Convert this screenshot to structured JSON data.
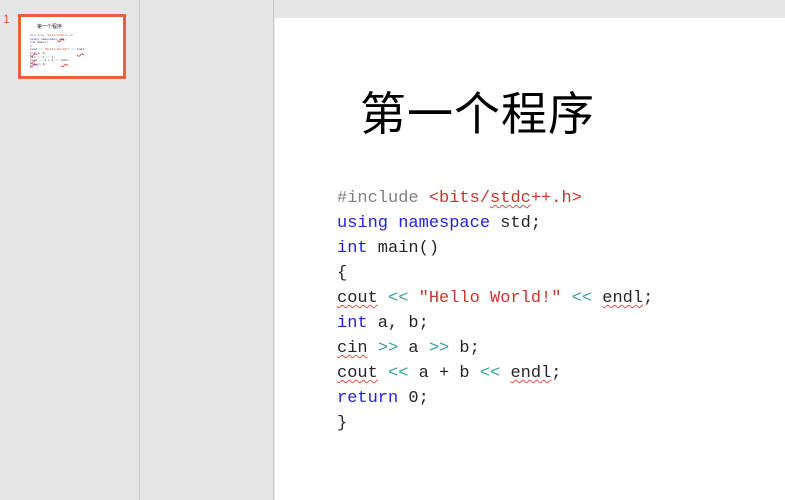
{
  "thumbnail_pane": {
    "slide_number": "1",
    "thumb_title": "第一个程序"
  },
  "slide": {
    "title": "第一个程序",
    "code_lines": [
      {
        "id": "line-include",
        "tokens": [
          {
            "text": "#include ",
            "color": "gray",
            "squiggle": false
          },
          {
            "text": "<bits/",
            "color": "red",
            "squiggle": false
          },
          {
            "text": "stdc",
            "color": "red",
            "squiggle": true
          },
          {
            "text": "++.h>",
            "color": "red",
            "squiggle": false
          }
        ]
      },
      {
        "id": "line-using",
        "tokens": [
          {
            "text": "using namespace",
            "color": "blue",
            "squiggle": false
          },
          {
            "text": " std;",
            "color": "black",
            "squiggle": false
          }
        ]
      },
      {
        "id": "line-main",
        "tokens": [
          {
            "text": "int",
            "color": "blue",
            "squiggle": false
          },
          {
            "text": " main()",
            "color": "black",
            "squiggle": false
          }
        ]
      },
      {
        "id": "line-open-brace",
        "tokens": [
          {
            "text": "{",
            "color": "black",
            "squiggle": false
          }
        ]
      },
      {
        "id": "line-cout-hello",
        "tokens": [
          {
            "text": "cout",
            "color": "black",
            "squiggle": true
          },
          {
            "text": " ",
            "color": "black",
            "squiggle": false
          },
          {
            "text": "<<",
            "color": "teal",
            "squiggle": false
          },
          {
            "text": " ",
            "color": "black",
            "squiggle": false
          },
          {
            "text": "\"Hello World!\"",
            "color": "red",
            "squiggle": false
          },
          {
            "text": " ",
            "color": "black",
            "squiggle": false
          },
          {
            "text": "<<",
            "color": "teal",
            "squiggle": false
          },
          {
            "text": " ",
            "color": "black",
            "squiggle": false
          },
          {
            "text": "endl",
            "color": "black",
            "squiggle": true
          },
          {
            "text": ";",
            "color": "black",
            "squiggle": false
          }
        ]
      },
      {
        "id": "line-int-ab",
        "tokens": [
          {
            "text": "int",
            "color": "blue",
            "squiggle": false
          },
          {
            "text": " a, b;",
            "color": "black",
            "squiggle": false
          }
        ]
      },
      {
        "id": "line-cin",
        "tokens": [
          {
            "text": "cin",
            "color": "black",
            "squiggle": true
          },
          {
            "text": " ",
            "color": "black",
            "squiggle": false
          },
          {
            "text": ">>",
            "color": "teal",
            "squiggle": false
          },
          {
            "text": " a ",
            "color": "black",
            "squiggle": false
          },
          {
            "text": ">>",
            "color": "teal",
            "squiggle": false
          },
          {
            "text": " b;",
            "color": "black",
            "squiggle": false
          }
        ]
      },
      {
        "id": "line-cout-sum",
        "tokens": [
          {
            "text": "cout",
            "color": "black",
            "squiggle": true
          },
          {
            "text": " ",
            "color": "black",
            "squiggle": false
          },
          {
            "text": "<<",
            "color": "teal",
            "squiggle": false
          },
          {
            "text": " a + b ",
            "color": "black",
            "squiggle": false
          },
          {
            "text": "<<",
            "color": "teal",
            "squiggle": false
          },
          {
            "text": " ",
            "color": "black",
            "squiggle": false
          },
          {
            "text": "endl",
            "color": "black",
            "squiggle": true
          },
          {
            "text": ";",
            "color": "black",
            "squiggle": false
          }
        ]
      },
      {
        "id": "line-return",
        "tokens": [
          {
            "text": "return",
            "color": "blue",
            "squiggle": false
          },
          {
            "text": " 0;",
            "color": "black",
            "squiggle": false
          }
        ]
      },
      {
        "id": "line-close-brace",
        "tokens": [
          {
            "text": "}",
            "color": "black",
            "squiggle": false
          }
        ]
      }
    ]
  },
  "colors": {
    "selection_border": "#e8603c",
    "slide_number": "#e0603c",
    "pane_background": "#e6e6e6",
    "pane_divider": "#c8c8c8",
    "keyword_blue": "#2222dd",
    "string_red": "#c0392b",
    "operator_teal": "#3aa0a0",
    "comment_gray": "#808080",
    "text_black": "#262626",
    "spellcheck_underline": "#e05050"
  }
}
